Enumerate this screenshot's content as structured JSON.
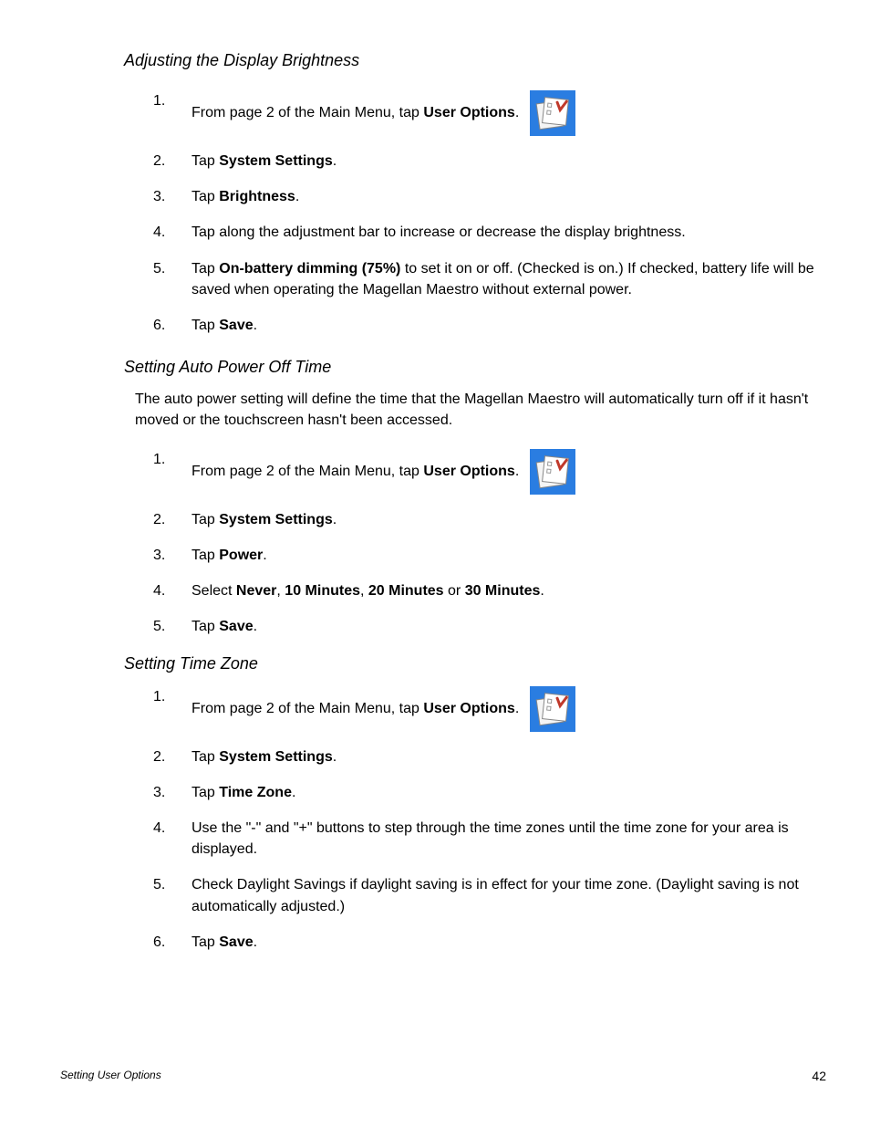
{
  "sections": [
    {
      "heading": "Adjusting the Display Brightness",
      "intro": null,
      "steps": [
        {
          "num": "1.",
          "pre": "From page 2 of the Main Menu, tap ",
          "bold": "User Options",
          "post": ".",
          "icon": true
        },
        {
          "num": "2.",
          "parts": [
            {
              "t": "Tap "
            },
            {
              "b": "System Settings"
            },
            {
              "t": "."
            }
          ]
        },
        {
          "num": "3.",
          "parts": [
            {
              "t": "Tap "
            },
            {
              "b": "Brightness"
            },
            {
              "t": "."
            }
          ]
        },
        {
          "num": "4.",
          "parts": [
            {
              "t": "Tap along the adjustment bar to increase or decrease the display brightness."
            }
          ]
        },
        {
          "num": "5.",
          "parts": [
            {
              "t": "Tap "
            },
            {
              "b": "On-battery dimming (75%)"
            },
            {
              "t": " to set it on or off. (Checked is on.) If checked, battery life will be saved when operating the Magellan Maestro without external power."
            }
          ]
        },
        {
          "num": "6.",
          "parts": [
            {
              "t": "Tap "
            },
            {
              "b": "Save"
            },
            {
              "t": "."
            }
          ]
        }
      ]
    },
    {
      "heading": "Setting Auto Power Off Time",
      "intro": "The auto power setting will define the time that the Magellan Maestro will automatically turn off if it hasn't moved or the touchscreen hasn't been accessed.",
      "steps": [
        {
          "num": "1.",
          "pre": "From page 2 of the Main Menu, tap ",
          "bold": "User Options",
          "post": ".",
          "icon": true
        },
        {
          "num": "2.",
          "parts": [
            {
              "t": "Tap "
            },
            {
              "b": "System Settings"
            },
            {
              "t": "."
            }
          ]
        },
        {
          "num": "3.",
          "parts": [
            {
              "t": "Tap "
            },
            {
              "b": "Power"
            },
            {
              "t": "."
            }
          ]
        },
        {
          "num": "4.",
          "parts": [
            {
              "t": "Select "
            },
            {
              "b": "Never"
            },
            {
              "t": ", "
            },
            {
              "b": "10 Minutes"
            },
            {
              "t": ", "
            },
            {
              "b": "20 Minutes"
            },
            {
              "t": " or "
            },
            {
              "b": "30 Minutes"
            },
            {
              "t": "."
            }
          ]
        },
        {
          "num": "5.",
          "parts": [
            {
              "t": "Tap "
            },
            {
              "b": "Save"
            },
            {
              "t": "."
            }
          ]
        }
      ]
    },
    {
      "heading": "Setting Time Zone",
      "intro": null,
      "steps": [
        {
          "num": "1.",
          "pre": "From page 2 of the Main Menu, tap ",
          "bold": "User Options",
          "post": ".",
          "icon": true
        },
        {
          "num": "2.",
          "parts": [
            {
              "t": "Tap "
            },
            {
              "b": "System Settings"
            },
            {
              "t": "."
            }
          ]
        },
        {
          "num": "3.",
          "parts": [
            {
              "t": "Tap "
            },
            {
              "b": "Time Zone"
            },
            {
              "t": "."
            }
          ]
        },
        {
          "num": "4.",
          "parts": [
            {
              "t": "Use the \"-\" and \"+\" buttons to step through the time zones until the time zone for your area is displayed."
            }
          ]
        },
        {
          "num": "5.",
          "parts": [
            {
              "t": "Check Daylight Savings if daylight saving is in effect for your time zone. (Daylight saving is not automatically adjusted.)"
            }
          ]
        },
        {
          "num": "6.",
          "parts": [
            {
              "t": "Tap "
            },
            {
              "b": "Save"
            },
            {
              "t": "."
            }
          ]
        }
      ]
    }
  ],
  "footer": {
    "left": "Setting User Options",
    "page": "42"
  }
}
